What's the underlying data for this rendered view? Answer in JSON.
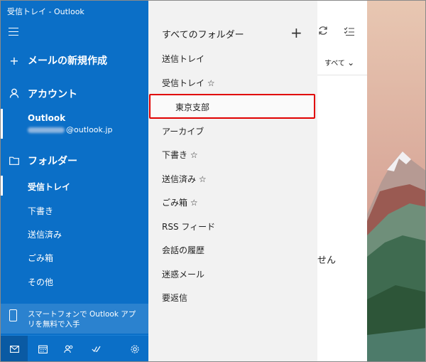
{
  "app": {
    "title": "受信トレイ - Outlook"
  },
  "nav": {
    "new_mail": "メールの新規作成",
    "accounts_header": "アカウント",
    "account": {
      "name": "Outlook",
      "email_domain": "@outlook.jp"
    },
    "folders_header": "フォルダー",
    "folders": [
      "受信トレイ",
      "下書き",
      "送信済み",
      "ごみ箱",
      "その他"
    ],
    "promo": "スマートフォンで Outlook アプリを無料で入手"
  },
  "flyout": {
    "title": "すべてのフォルダー",
    "items": [
      "送信トレイ",
      "受信トレイ ☆",
      "東京支部",
      "アーカイブ",
      "下書き ☆",
      "送信済み ☆",
      "ごみ箱 ☆",
      "RSS フィード",
      "会話の履歴",
      "迷惑メール",
      "要返信"
    ]
  },
  "list": {
    "filter_label": "すべて",
    "partial_text": "せん"
  },
  "colors": {
    "nav_blue": "#0b6fc7",
    "flyout_bg": "#f2f2f2",
    "highlight_red": "#e00000"
  }
}
